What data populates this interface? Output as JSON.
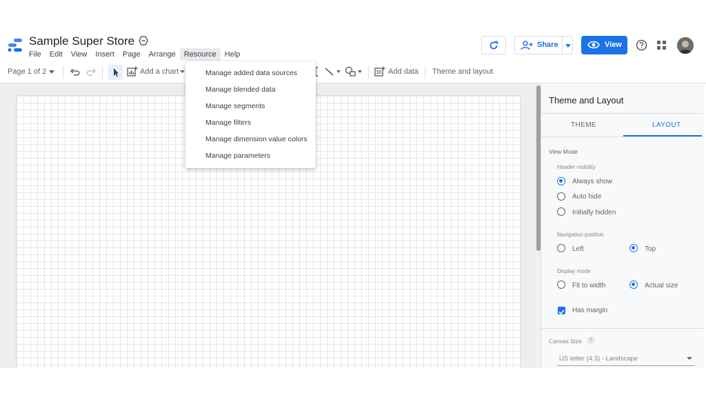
{
  "header": {
    "title": "Sample Super Store",
    "menu": [
      "File",
      "Edit",
      "View",
      "Insert",
      "Page",
      "Arrange",
      "Resource",
      "Help"
    ],
    "active_menu": "Resource",
    "share_label": "Share",
    "view_label": "View"
  },
  "toolbar": {
    "page_indicator": "Page 1 of 2",
    "add_chart_label": "Add a chart",
    "add_data_label": "Add data",
    "theme_layout_label": "Theme and layout"
  },
  "resource_menu": {
    "items": [
      "Manage added data sources",
      "Manage blended data",
      "Manage segments",
      "Manage filters",
      "Manage dimension value colors",
      "Manage parameters"
    ]
  },
  "panel": {
    "title": "Theme and Layout",
    "tabs": [
      "THEME",
      "LAYOUT"
    ],
    "active_tab": "LAYOUT",
    "view_mode_label": "View Mode",
    "header_visibility_label": "Header visibility",
    "header_visibility_options": [
      "Always show",
      "Auto hide",
      "Initially hidden"
    ],
    "header_visibility_selected": "Always show",
    "navigation_position_label": "Navigation position",
    "navigation_options": [
      "Left",
      "Top"
    ],
    "navigation_selected": "Top",
    "display_mode_label": "Display mode",
    "display_mode_options": [
      "Fit to width",
      "Actual size"
    ],
    "display_mode_selected": "Actual size",
    "has_margin_label": "Has margin",
    "has_margin_checked": true,
    "canvas_size_label": "Canvas Size",
    "canvas_size_value": "US letter (4:3) - Landscape"
  },
  "colors": {
    "accent": "#1a73e8",
    "text": "#3c4043"
  }
}
